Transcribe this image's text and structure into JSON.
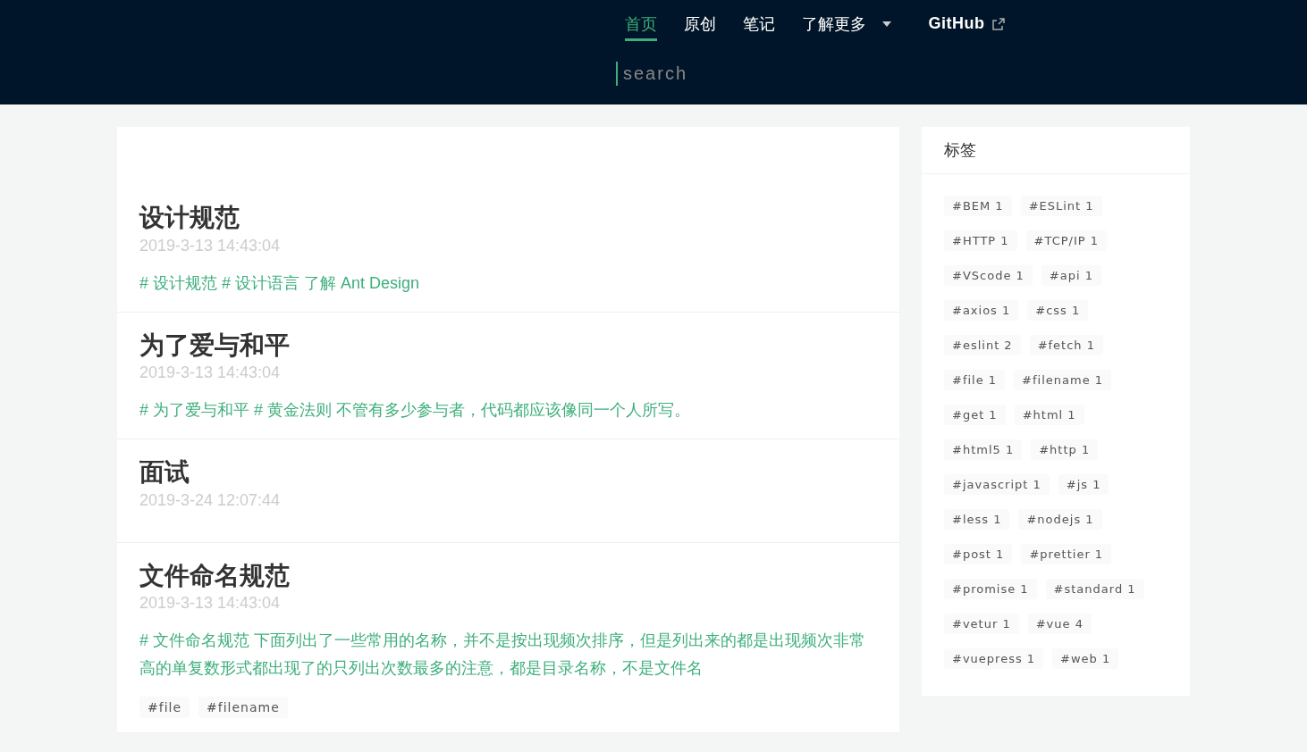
{
  "nav": {
    "items": [
      {
        "label": "首页",
        "selected": true,
        "kind": "link"
      },
      {
        "label": "原创",
        "selected": false,
        "kind": "link"
      },
      {
        "label": "笔记",
        "selected": false,
        "kind": "link"
      },
      {
        "label": "了解更多",
        "selected": false,
        "kind": "dropdown"
      },
      {
        "label": "GitHub",
        "selected": false,
        "kind": "external"
      }
    ],
    "search": {
      "placeholder": "search"
    }
  },
  "posts": [
    {
      "title": "设计规范",
      "date": "2019-3-13 14:43:04",
      "summary": "# 设计规范 # 设计语言 了解 Ant Design"
    },
    {
      "title": "为了爱与和平",
      "date": "2019-3-13 14:43:04",
      "summary": "# 为了爱与和平 # 黄金法则 不管有多少参与者，代码都应该像同一个人所写。"
    },
    {
      "title": "面试",
      "date": "2019-3-24 12:07:44"
    },
    {
      "title": "文件命名规范",
      "date": "2019-3-13 14:43:04",
      "summary": "# 文件命名规范 下面列出了一些常用的名称，并不是按出现频次排序，但是列出来的都是出现频次非常高的单复数形式都出现了的只列出次数最多的注意，都是目录名称，不是文件名",
      "tags": [
        "#file",
        "#filename"
      ]
    }
  ],
  "sidebar": {
    "title": "标签",
    "tags": [
      "#BEM 1",
      "#ESLint 1",
      "#HTTP 1",
      "#TCP/IP 1",
      "#VScode 1",
      "#api 1",
      "#axios 1",
      "#css 1",
      "#eslint 2",
      "#fetch 1",
      "#file 1",
      "#filename 1",
      "#get 1",
      "#html 1",
      "#html5 1",
      "#http 1",
      "#javascript 1",
      "#js 1",
      "#less 1",
      "#nodejs 1",
      "#post 1",
      "#prettier 1",
      "#promise 1",
      "#standard 1",
      "#vetur 1",
      "#vue 4",
      "#vuepress 1",
      "#web 1"
    ]
  }
}
